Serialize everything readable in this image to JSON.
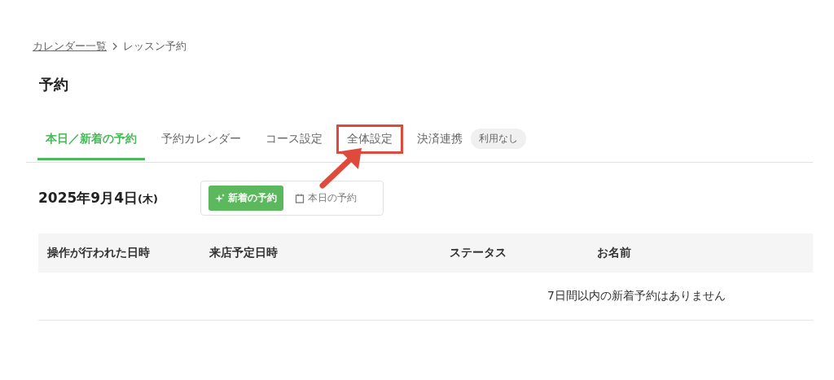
{
  "breadcrumb": [
    {
      "label": "カレンダー一覧",
      "link": true
    },
    {
      "label": "レッスン予約",
      "link": false
    }
  ],
  "title": "予約",
  "tabs": [
    {
      "label": "本日／新着の予約",
      "selected": true,
      "highlighted": false
    },
    {
      "label": "予約カレンダー",
      "selected": false,
      "highlighted": false
    },
    {
      "label": "コース設定",
      "selected": false,
      "highlighted": false
    },
    {
      "label": "全体設定",
      "selected": false,
      "highlighted": true
    },
    {
      "label": "決済連携",
      "selected": false,
      "highlighted": false,
      "badge": "利用なし"
    }
  ],
  "date": {
    "main": "2025年9月4日",
    "weekday": "(木)"
  },
  "toggle": [
    {
      "label": "新着の予約",
      "kind": "sparkle",
      "selected": true
    },
    {
      "label": "本日の予約",
      "kind": "calendar",
      "selected": false
    }
  ],
  "table": {
    "columns": [
      "操作が行われた日時",
      "来店予定日時",
      "ステータス",
      "お名前"
    ],
    "empty_message": "7日間以内の新着予約はありません"
  }
}
